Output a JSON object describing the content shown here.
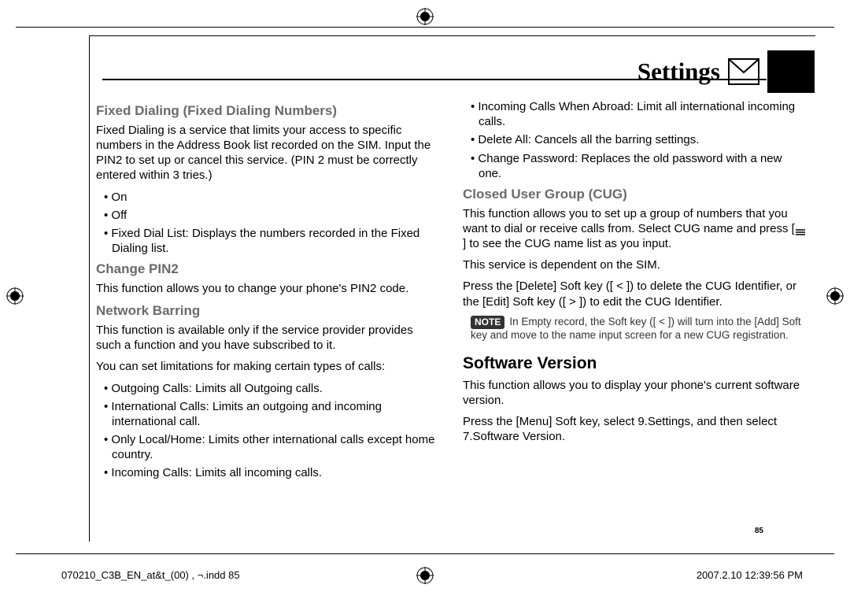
{
  "header": {
    "title": "Settings"
  },
  "left_col": {
    "h1": "Fixed Dialing (Fixed Dialing Numbers)",
    "p1": "Fixed Dialing is a service that limits your access to specific numbers in the Address Book list recorded on the SIM. Input the PIN2 to set up or cancel this service. (PIN 2 must be correctly entered within 3 tries.)",
    "b1": "On",
    "b2": "Off",
    "b3": "Fixed Dial List: Displays the numbers recorded in the Fixed Dialing list.",
    "h2": "Change PIN2",
    "p2": "This function allows you to change your phone's PIN2 code.",
    "h3": "Network Barring",
    "p3": "This function is available only if the service provider provides such a function and you have subscribed to it.",
    "p4": "You can set limitations for making certain types of calls:",
    "b4": "Outgoing Calls: Limits all Outgoing calls.",
    "b5": "International Calls: Limits an outgoing and incoming international call.",
    "b6": "Only Local/Home: Limits other international calls except home country.",
    "b7": "Incoming Calls: Limits all incoming calls."
  },
  "right_col": {
    "b1": "Incoming Calls When Abroad: Limit all international incoming calls.",
    "b2": "Delete All: Cancels all the barring settings.",
    "b3": "Change Password: Replaces the old password with a new one.",
    "h1": "Closed User Group (CUG)",
    "p1a": "This function allows you to set up a group of numbers that you want to dial or receive calls from. Select CUG name and press [",
    "p1b": "] to see the CUG name list as you input.",
    "p2": "This service is dependent on the SIM.",
    "p3": "Press the [Delete] Soft key ([ < ]) to delete the CUG Identifier, or the [Edit] Soft key ([ > ]) to edit the CUG Identifier.",
    "note_label": "NOTE",
    "note": "In Empty record, the Soft key ([ < ]) will turn into the [Add] Soft key and move to the name input screen for a new CUG registration.",
    "h2": "Software Version",
    "p4": "This function allows you to display your phone's current software version.",
    "p5": "Press the [Menu] Soft key, select 9.Settings, and then select 7.Software Version."
  },
  "page_num": "85",
  "footer": {
    "left": "070210_C3B_EN_at&t_(00) , ¬.indd   85",
    "right": "2007.2.10   12:39:56 PM"
  }
}
